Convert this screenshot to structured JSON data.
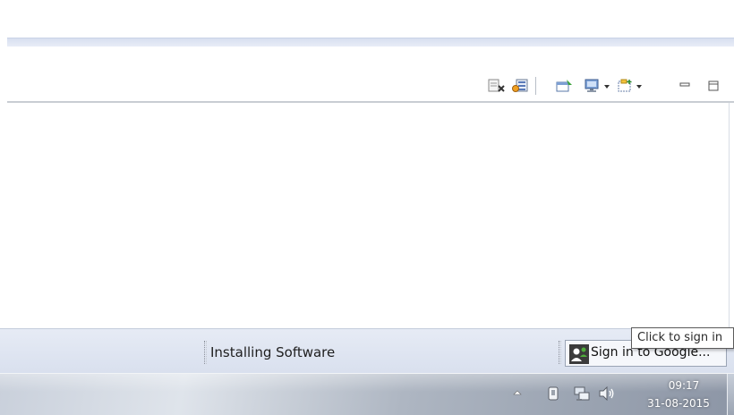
{
  "toolbar": {
    "icons": [
      "remove-all-terminated-icon",
      "remove-launch-icon",
      "open-console-icon",
      "display-selected-console-icon",
      "open-new-console-icon",
      "minimize-icon",
      "maximize-icon"
    ]
  },
  "status_bar": {
    "progress_text": "Installing Software",
    "signin_label": "Sign in to Google...",
    "tooltip": "Click to sign in"
  },
  "taskbar": {
    "time": "09:17",
    "date": "31-08-2015",
    "tray_icons": [
      "show-hidden-icons-icon",
      "usb-device-icon",
      "network-icon",
      "volume-icon"
    ]
  }
}
